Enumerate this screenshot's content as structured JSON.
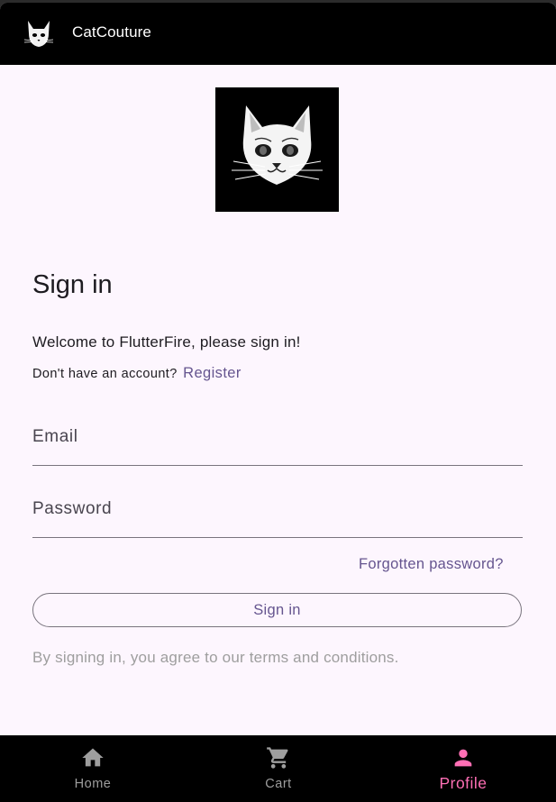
{
  "app": {
    "title": "CatCouture"
  },
  "signin": {
    "heading": "Sign in",
    "welcome": "Welcome to FlutterFire, please sign in!",
    "no_account": "Don't have an account?",
    "register_link": "Register",
    "email_label": "Email",
    "password_label": "Password",
    "forgot_link": "Forgotten password?",
    "submit_label": "Sign in",
    "terms": "By signing in, you agree to our terms and conditions."
  },
  "nav": {
    "items": [
      {
        "label": "Home",
        "icon": "home-icon"
      },
      {
        "label": "Cart",
        "icon": "cart-icon"
      },
      {
        "label": "Profile",
        "icon": "person-icon"
      }
    ],
    "active": "Profile"
  },
  "colors": {
    "accent": "#65558f",
    "active_nav": "#ff6fb5",
    "background": "#fdf6fe",
    "bar": "#000000"
  }
}
